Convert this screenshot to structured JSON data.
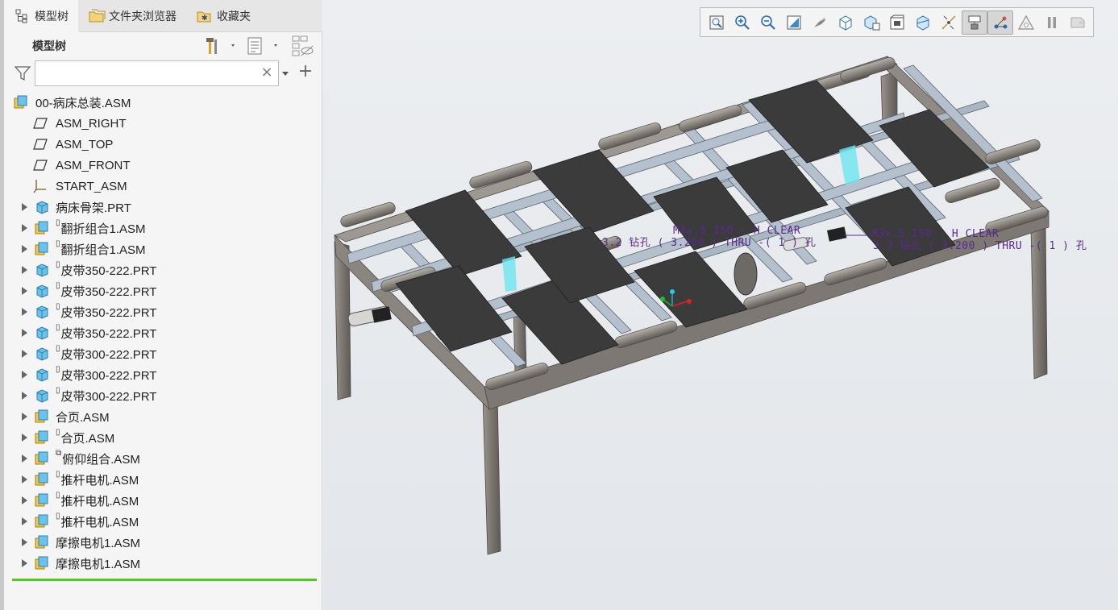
{
  "tabs": [
    {
      "label": "模型树",
      "icon": "model-tree-icon",
      "active": true
    },
    {
      "label": "文件夹浏览器",
      "icon": "folder-browser-icon",
      "active": false
    },
    {
      "label": "收藏夹",
      "icon": "favorites-icon",
      "active": false
    }
  ],
  "tree_header": {
    "title": "模型树"
  },
  "search": {
    "value": "",
    "placeholder": ""
  },
  "tree": [
    {
      "label": "00-病床总装.ASM",
      "type": "assembly-root",
      "expandable": false
    },
    {
      "label": "ASM_RIGHT",
      "type": "datum-plane",
      "expandable": false
    },
    {
      "label": "ASM_TOP",
      "type": "datum-plane",
      "expandable": false
    },
    {
      "label": "ASM_FRONT",
      "type": "datum-plane",
      "expandable": false
    },
    {
      "label": "START_ASM",
      "type": "coordinate-system",
      "expandable": false
    },
    {
      "label": "病床骨架.PRT",
      "type": "part",
      "expandable": true,
      "flag": ""
    },
    {
      "label": "翻折组合1.ASM",
      "type": "assembly",
      "expandable": true,
      "flag": "▯"
    },
    {
      "label": "翻折组合1.ASM",
      "type": "assembly",
      "expandable": true,
      "flag": "▯"
    },
    {
      "label": "皮带350-222.PRT",
      "type": "part",
      "expandable": true,
      "flag": "▯"
    },
    {
      "label": "皮带350-222.PRT",
      "type": "part",
      "expandable": true,
      "flag": "▯"
    },
    {
      "label": "皮带350-222.PRT",
      "type": "part",
      "expandable": true,
      "flag": "▯"
    },
    {
      "label": "皮带350-222.PRT",
      "type": "part",
      "expandable": true,
      "flag": "▯"
    },
    {
      "label": "皮带300-222.PRT",
      "type": "part",
      "expandable": true,
      "flag": "▯"
    },
    {
      "label": "皮带300-222.PRT",
      "type": "part",
      "expandable": true,
      "flag": "▯"
    },
    {
      "label": "皮带300-222.PRT",
      "type": "part",
      "expandable": true,
      "flag": "▯"
    },
    {
      "label": "合页.ASM",
      "type": "assembly",
      "expandable": true,
      "flag": ""
    },
    {
      "label": "合页.ASM",
      "type": "assembly",
      "expandable": true,
      "flag": "▯"
    },
    {
      "label": "俯仰组合.ASM",
      "type": "assembly",
      "expandable": true,
      "flag": "⧉"
    },
    {
      "label": "推杆电机.ASM",
      "type": "assembly",
      "expandable": true,
      "flag": "▯"
    },
    {
      "label": "推杆电机.ASM",
      "type": "assembly",
      "expandable": true,
      "flag": "▯"
    },
    {
      "label": "推杆电机.ASM",
      "type": "assembly",
      "expandable": true,
      "flag": "▯"
    },
    {
      "label": "摩擦电机1.ASM",
      "type": "assembly",
      "expandable": true,
      "flag": ""
    },
    {
      "label": "摩擦电机1.ASM",
      "type": "assembly",
      "expandable": true,
      "flag": ""
    }
  ],
  "view_toolbar": [
    {
      "icon": "refit-icon",
      "active": false
    },
    {
      "icon": "zoom-in-icon",
      "active": false
    },
    {
      "icon": "zoom-out-icon",
      "active": false
    },
    {
      "icon": "repaint-icon",
      "active": false
    },
    {
      "icon": "display-style-icon",
      "active": false
    },
    {
      "icon": "saved-orientations-icon",
      "active": false
    },
    {
      "icon": "view-manager-icon",
      "active": false
    },
    {
      "icon": "perspective-view-icon",
      "active": false
    },
    {
      "icon": "section-view-icon",
      "active": false
    },
    {
      "icon": "datum-display-icon",
      "active": false
    },
    {
      "icon": "annotation-display-icon",
      "active": true
    },
    {
      "icon": "spin-center-icon",
      "active": true
    },
    {
      "icon": "appearance-icon",
      "active": false
    },
    {
      "icon": "pause-icon",
      "active": false
    },
    {
      "icon": "next-icon",
      "active": false
    }
  ],
  "annotations": [
    {
      "line1": "M3x.5 ISO - H CLEAR",
      "line2": "3.2 钻孔 ( 3.200 )  THRU  -( 1 ) 孔"
    },
    {
      "line1": "M3x.5 ISO - H CLEAR",
      "line2": "3.2 钻孔 ( 3.200 )  THRU  -( 1 ) 孔"
    }
  ],
  "colors": {
    "frame": "#8a8580",
    "frame_dark": "#5e5954",
    "rail": "#aab6c4",
    "belt": "#3b3b3b",
    "roller": "#8f8a83",
    "accent_green": "#5cbf3c",
    "annotation": "#5a2a8a"
  }
}
